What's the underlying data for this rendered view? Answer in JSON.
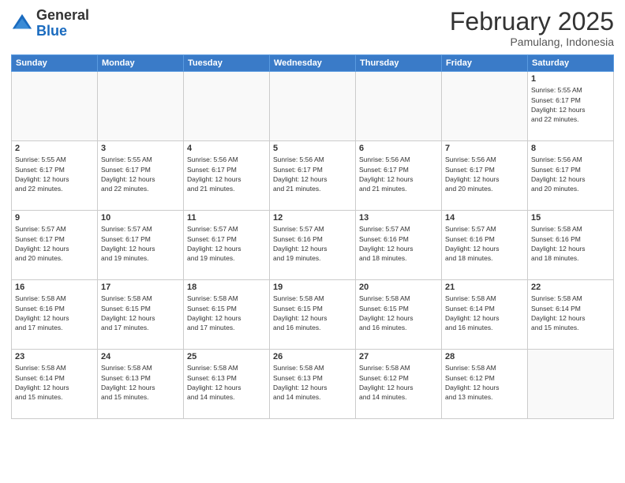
{
  "header": {
    "logo_general": "General",
    "logo_blue": "Blue",
    "month_title": "February 2025",
    "subtitle": "Pamulang, Indonesia"
  },
  "days_of_week": [
    "Sunday",
    "Monday",
    "Tuesday",
    "Wednesday",
    "Thursday",
    "Friday",
    "Saturday"
  ],
  "weeks": [
    [
      {
        "day": "",
        "info": ""
      },
      {
        "day": "",
        "info": ""
      },
      {
        "day": "",
        "info": ""
      },
      {
        "day": "",
        "info": ""
      },
      {
        "day": "",
        "info": ""
      },
      {
        "day": "",
        "info": ""
      },
      {
        "day": "1",
        "info": "Sunrise: 5:55 AM\nSunset: 6:17 PM\nDaylight: 12 hours\nand 22 minutes."
      }
    ],
    [
      {
        "day": "2",
        "info": "Sunrise: 5:55 AM\nSunset: 6:17 PM\nDaylight: 12 hours\nand 22 minutes."
      },
      {
        "day": "3",
        "info": "Sunrise: 5:55 AM\nSunset: 6:17 PM\nDaylight: 12 hours\nand 22 minutes."
      },
      {
        "day": "4",
        "info": "Sunrise: 5:56 AM\nSunset: 6:17 PM\nDaylight: 12 hours\nand 21 minutes."
      },
      {
        "day": "5",
        "info": "Sunrise: 5:56 AM\nSunset: 6:17 PM\nDaylight: 12 hours\nand 21 minutes."
      },
      {
        "day": "6",
        "info": "Sunrise: 5:56 AM\nSunset: 6:17 PM\nDaylight: 12 hours\nand 21 minutes."
      },
      {
        "day": "7",
        "info": "Sunrise: 5:56 AM\nSunset: 6:17 PM\nDaylight: 12 hours\nand 20 minutes."
      },
      {
        "day": "8",
        "info": "Sunrise: 5:56 AM\nSunset: 6:17 PM\nDaylight: 12 hours\nand 20 minutes."
      }
    ],
    [
      {
        "day": "9",
        "info": "Sunrise: 5:57 AM\nSunset: 6:17 PM\nDaylight: 12 hours\nand 20 minutes."
      },
      {
        "day": "10",
        "info": "Sunrise: 5:57 AM\nSunset: 6:17 PM\nDaylight: 12 hours\nand 19 minutes."
      },
      {
        "day": "11",
        "info": "Sunrise: 5:57 AM\nSunset: 6:17 PM\nDaylight: 12 hours\nand 19 minutes."
      },
      {
        "day": "12",
        "info": "Sunrise: 5:57 AM\nSunset: 6:16 PM\nDaylight: 12 hours\nand 19 minutes."
      },
      {
        "day": "13",
        "info": "Sunrise: 5:57 AM\nSunset: 6:16 PM\nDaylight: 12 hours\nand 18 minutes."
      },
      {
        "day": "14",
        "info": "Sunrise: 5:57 AM\nSunset: 6:16 PM\nDaylight: 12 hours\nand 18 minutes."
      },
      {
        "day": "15",
        "info": "Sunrise: 5:58 AM\nSunset: 6:16 PM\nDaylight: 12 hours\nand 18 minutes."
      }
    ],
    [
      {
        "day": "16",
        "info": "Sunrise: 5:58 AM\nSunset: 6:16 PM\nDaylight: 12 hours\nand 17 minutes."
      },
      {
        "day": "17",
        "info": "Sunrise: 5:58 AM\nSunset: 6:15 PM\nDaylight: 12 hours\nand 17 minutes."
      },
      {
        "day": "18",
        "info": "Sunrise: 5:58 AM\nSunset: 6:15 PM\nDaylight: 12 hours\nand 17 minutes."
      },
      {
        "day": "19",
        "info": "Sunrise: 5:58 AM\nSunset: 6:15 PM\nDaylight: 12 hours\nand 16 minutes."
      },
      {
        "day": "20",
        "info": "Sunrise: 5:58 AM\nSunset: 6:15 PM\nDaylight: 12 hours\nand 16 minutes."
      },
      {
        "day": "21",
        "info": "Sunrise: 5:58 AM\nSunset: 6:14 PM\nDaylight: 12 hours\nand 16 minutes."
      },
      {
        "day": "22",
        "info": "Sunrise: 5:58 AM\nSunset: 6:14 PM\nDaylight: 12 hours\nand 15 minutes."
      }
    ],
    [
      {
        "day": "23",
        "info": "Sunrise: 5:58 AM\nSunset: 6:14 PM\nDaylight: 12 hours\nand 15 minutes."
      },
      {
        "day": "24",
        "info": "Sunrise: 5:58 AM\nSunset: 6:13 PM\nDaylight: 12 hours\nand 15 minutes."
      },
      {
        "day": "25",
        "info": "Sunrise: 5:58 AM\nSunset: 6:13 PM\nDaylight: 12 hours\nand 14 minutes."
      },
      {
        "day": "26",
        "info": "Sunrise: 5:58 AM\nSunset: 6:13 PM\nDaylight: 12 hours\nand 14 minutes."
      },
      {
        "day": "27",
        "info": "Sunrise: 5:58 AM\nSunset: 6:12 PM\nDaylight: 12 hours\nand 14 minutes."
      },
      {
        "day": "28",
        "info": "Sunrise: 5:58 AM\nSunset: 6:12 PM\nDaylight: 12 hours\nand 13 minutes."
      },
      {
        "day": "",
        "info": ""
      }
    ]
  ]
}
